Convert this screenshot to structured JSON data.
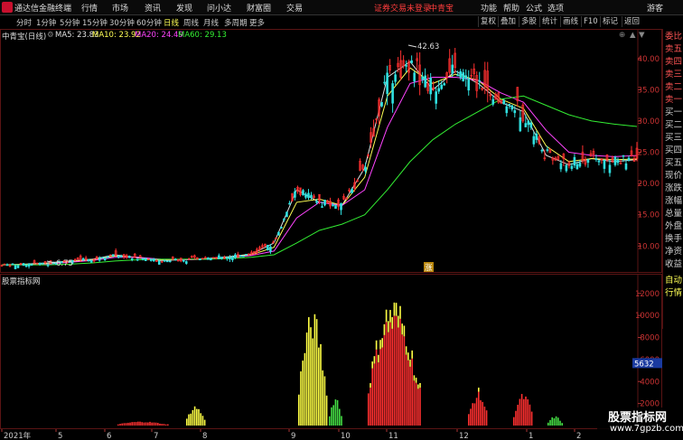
{
  "app": {
    "title": "通达信金融终端",
    "menu": [
      "行情",
      "市场",
      "资讯",
      "发现",
      "问小达",
      "财富圈",
      "交易"
    ],
    "alert": "证券交易未登录",
    "stock_name_top": "中青宝",
    "right_menu": [
      "功能",
      "帮助",
      "公式",
      "选项",
      "游客"
    ]
  },
  "toolbar": {
    "periods": [
      "分时",
      "1分钟",
      "5分钟",
      "15分钟",
      "30分钟",
      "60分钟",
      "日线",
      "周线",
      "月线",
      "多周期",
      "更多"
    ],
    "active_period": "日线",
    "tools": [
      "复权",
      "叠加",
      "多股",
      "统计",
      "画线",
      "F10",
      "标记",
      "返回"
    ]
  },
  "main_chart": {
    "header": "中青宝(日线)",
    "ma": [
      {
        "label": "MA5: 23.83",
        "color": "#e0e0e0"
      },
      {
        "label": "MA10: 23.92",
        "color": "#ffff55"
      },
      {
        "label": "MA20: 24.49",
        "color": "#ff44ff"
      },
      {
        "label": "MA60: 29.13",
        "color": "#33ee33"
      }
    ],
    "high_label": "42.63",
    "low_label": "6.75",
    "badge": "涨"
  },
  "sub_chart": {
    "header": "股票指标网",
    "current_value": "5632"
  },
  "side_panel": {
    "items": [
      "委比",
      "卖五",
      "卖四",
      "卖三",
      "卖二",
      "卖一",
      "买一",
      "买二",
      "买三",
      "买四",
      "买五",
      "现价",
      "涨跌",
      "涨幅",
      "总量",
      "外盘",
      "换手",
      "净资",
      "收益"
    ],
    "bottom_items": [
      "自动",
      "行情"
    ]
  },
  "watermark": {
    "title": "股票指标网",
    "url": "www.7gpzb.com"
  },
  "chart_data": [
    {
      "type": "line",
      "title": "中青宝(日线)",
      "ylim": [
        6,
        43
      ],
      "y_ticks": [
        10.0,
        15.0,
        20.0,
        25.0,
        30.0,
        35.0,
        40.0
      ],
      "x_ticks": [
        "2021年",
        "5",
        "6",
        "7",
        "8",
        "9",
        "10",
        "11",
        "12",
        "1",
        "2"
      ],
      "series": [
        {
          "name": "MA5",
          "values": [
            7.0,
            7.1,
            7.3,
            7.6,
            7.9,
            8.6,
            8.1,
            7.7,
            7.8,
            8.0,
            8.3,
            8.7,
            10.5,
            19.0,
            17.0,
            16.5,
            22.5,
            37.0,
            39.5,
            35.0,
            38.0,
            36.0,
            33.0,
            31.5,
            24.5,
            23.0,
            24.0,
            23.5,
            23.83
          ]
        },
        {
          "name": "MA10",
          "values": [
            7.0,
            7.05,
            7.2,
            7.5,
            7.8,
            8.4,
            8.2,
            7.8,
            7.8,
            7.9,
            8.2,
            8.6,
            9.8,
            17.0,
            17.5,
            16.5,
            21.0,
            34.0,
            38.5,
            36.0,
            37.5,
            36.5,
            33.5,
            32.0,
            26.0,
            23.5,
            24.0,
            23.8,
            23.92
          ]
        },
        {
          "name": "MA20",
          "values": [
            7.0,
            7.0,
            7.1,
            7.4,
            7.7,
            8.2,
            8.2,
            7.9,
            7.8,
            7.9,
            8.1,
            8.5,
            9.2,
            14.5,
            17.0,
            16.5,
            19.0,
            29.0,
            36.0,
            37.0,
            37.0,
            36.5,
            34.5,
            33.0,
            28.5,
            25.0,
            24.5,
            24.3,
            24.49
          ]
        },
        {
          "name": "MA60",
          "values": [
            7.0,
            7.0,
            7.0,
            7.1,
            7.3,
            7.6,
            7.8,
            7.9,
            7.9,
            7.9,
            8.0,
            8.2,
            8.6,
            10.5,
            12.5,
            13.5,
            15.0,
            19.0,
            23.5,
            27.0,
            29.5,
            31.5,
            33.5,
            34.0,
            32.5,
            31.0,
            30.0,
            29.5,
            29.13
          ]
        }
      ]
    },
    {
      "type": "bar",
      "title": "股票指标网",
      "ylim": [
        0,
        12800
      ],
      "y_ticks": [
        2000,
        4000,
        6000,
        8000,
        10000,
        12000
      ],
      "current_value": 5632
    }
  ]
}
